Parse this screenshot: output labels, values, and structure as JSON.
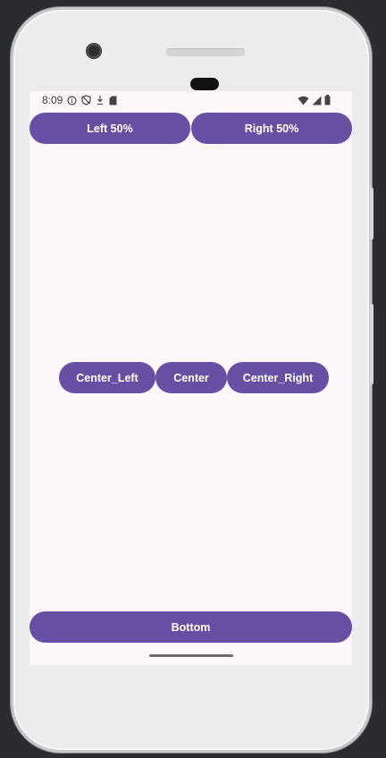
{
  "status_bar": {
    "time": "8:09",
    "left_icons": [
      "info-icon",
      "shield-icon",
      "download-icon",
      "sd-card-icon"
    ],
    "right_icons": [
      "wifi-icon",
      "signal-icon",
      "battery-icon"
    ]
  },
  "buttons": {
    "left": "Left 50%",
    "right": "Right 50%",
    "center_left": "Center_Left",
    "center": "Center",
    "center_right": "Center_Right",
    "bottom": "Bottom"
  },
  "colors": {
    "button": "#6750a4",
    "screen_bg": "#fdf7fc",
    "button_text": "#ffffff"
  }
}
